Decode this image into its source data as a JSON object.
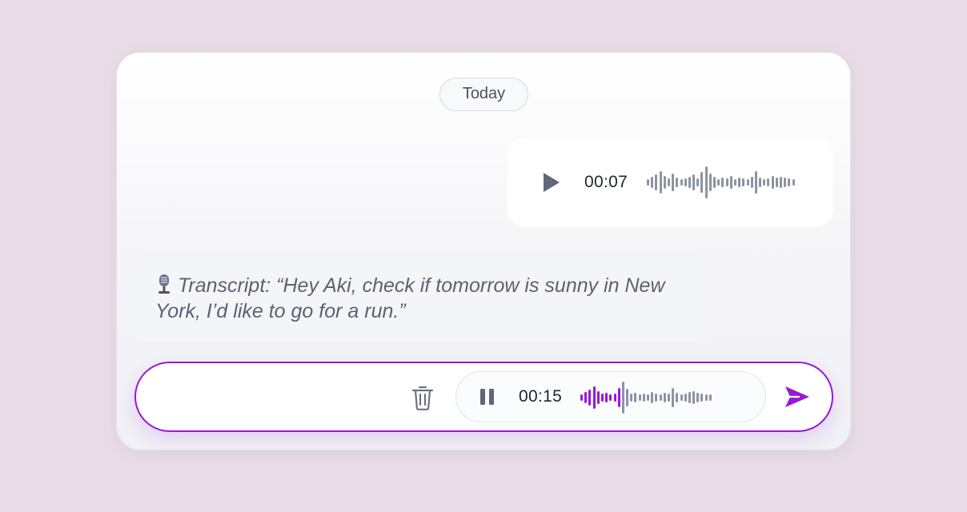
{
  "chat": {
    "date_label": "Today",
    "voice_message": {
      "duration": "00:07",
      "icon": "play-icon"
    },
    "transcript": {
      "icon": "microphone-icon",
      "text": "Transcript: “Hey Aki, check if tomorrow is sunny in New York, I’d like to go for a run.”"
    }
  },
  "composer": {
    "delete_icon": "trash-icon",
    "recording": {
      "elapsed": "00:15",
      "state": "recording",
      "icon": "pause-icon"
    },
    "send_icon": "send-icon"
  },
  "colors": {
    "background": "#e8dde6",
    "accent": "#9a18d6",
    "waveform_idle": "#8c94a3",
    "text_muted": "#5b6272"
  }
}
